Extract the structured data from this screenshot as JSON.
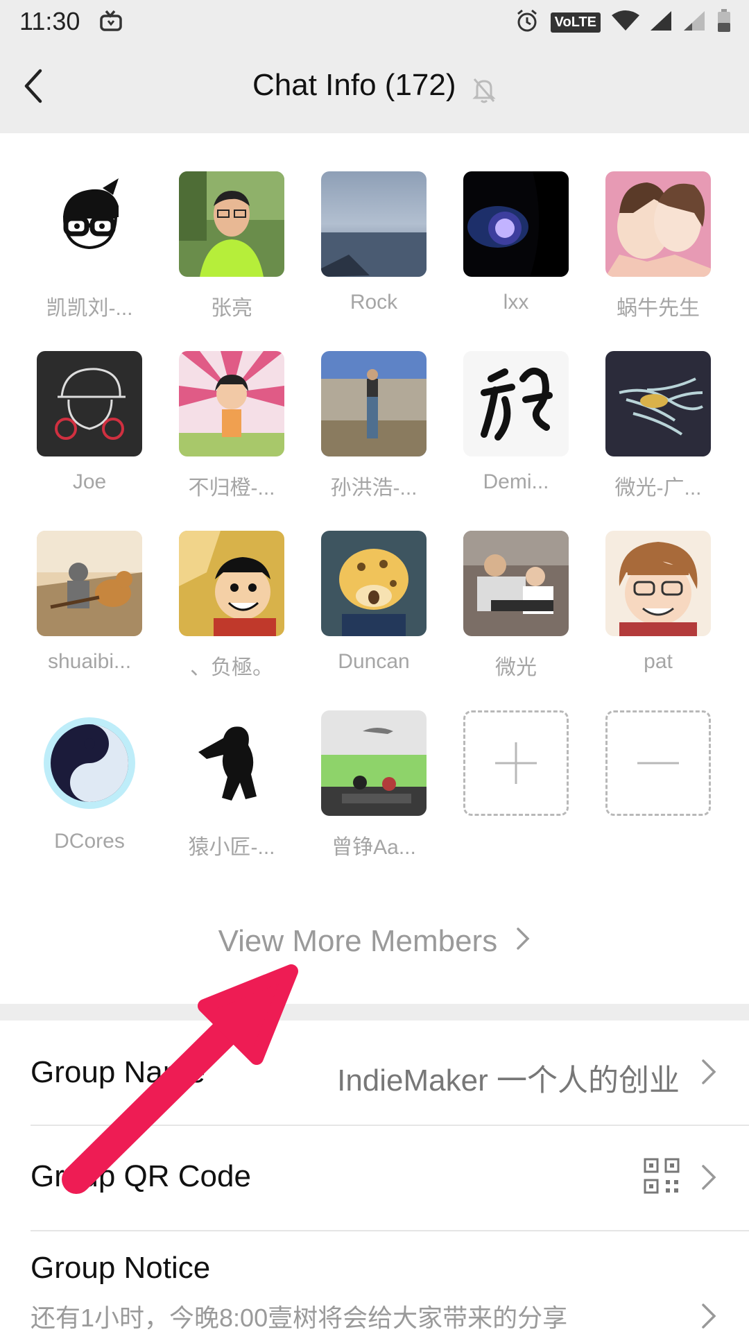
{
  "status_bar": {
    "time": "11:30",
    "volte": "VoLTE"
  },
  "header": {
    "title": "Chat Info (172)"
  },
  "members": [
    {
      "name": "凯凯刘-...",
      "avatar": "cartoon-glasses"
    },
    {
      "name": "张亮",
      "avatar": "photo-man-green"
    },
    {
      "name": "Rock",
      "avatar": "photo-sea"
    },
    {
      "name": "lxx",
      "avatar": "photo-dark"
    },
    {
      "name": "蜗牛先生",
      "avatar": "illustration-couple"
    },
    {
      "name": "Joe",
      "avatar": "sketch-cap"
    },
    {
      "name": "不归橙-...",
      "avatar": "cartoon-girl"
    },
    {
      "name": "孙洪浩-...",
      "avatar": "photo-landscape"
    },
    {
      "name": "Demi...",
      "avatar": "calligraphy"
    },
    {
      "name": "微光-广...",
      "avatar": "art-feathers"
    },
    {
      "name": "shuaibi...",
      "avatar": "photo-guitar-dog"
    },
    {
      "name": "、负極。",
      "avatar": "anime-pirate"
    },
    {
      "name": "Duncan",
      "avatar": "cartoon-cheetah"
    },
    {
      "name": "微光",
      "avatar": "photo-father-child"
    },
    {
      "name": "pat",
      "avatar": "anime-glasses"
    },
    {
      "name": "DCores",
      "avatar": "yin-yang"
    },
    {
      "name": "猿小匠-...",
      "avatar": "silhouette-ape"
    },
    {
      "name": "曾铮Aa...",
      "avatar": "photo-classroom"
    }
  ],
  "view_more": "View More Members",
  "settings": {
    "group_name_label": "Group Name",
    "group_name_value": "IndieMaker 一个人的创业",
    "qr_label": "Group QR Code",
    "notice_label": "Group Notice",
    "notice_text": "还有1小时，今晚8:00壹树将会给大家带来的分享"
  },
  "colors": {
    "accent_arrow": "#ee1c54",
    "background": "#ededed"
  }
}
